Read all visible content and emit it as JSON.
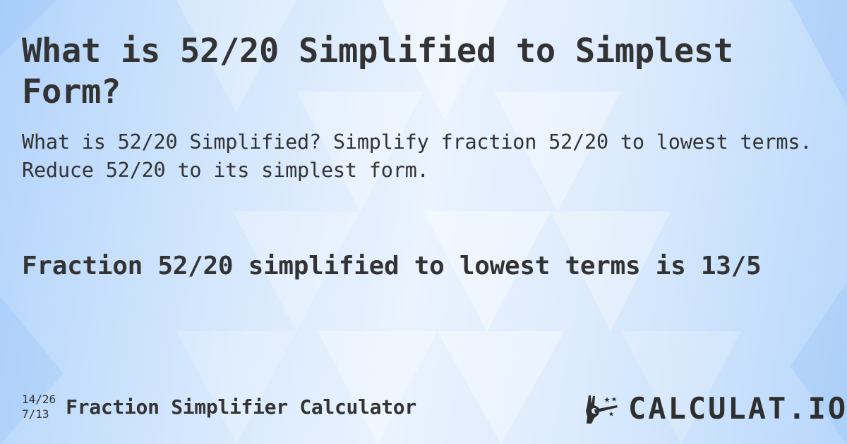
{
  "title": "What is 52/20 Simplified to Simplest Form?",
  "description": "What is 52/20 Simplified? Simplify fraction 52/20 to lowest terms. Reduce 52/20 to its simplest form.",
  "answer": "Fraction 52/20 simplified to lowest terms is 13/5",
  "footer": {
    "fraction_top": "14/26",
    "fraction_bottom": "7/13",
    "calculator_name": "Fraction Simplifier Calculator"
  },
  "logo": {
    "text": "CALCULAT.IO",
    "icon": "magic-wand-hand-icon"
  },
  "colors": {
    "text": "#333333",
    "background_light": "#eaf3fe",
    "background_blue": "#b3d4fb"
  }
}
